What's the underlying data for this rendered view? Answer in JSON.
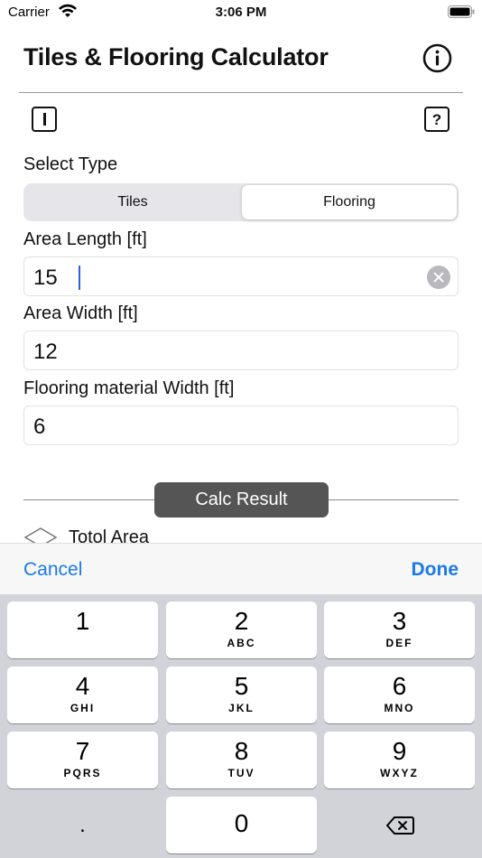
{
  "status_bar": {
    "carrier": "Carrier",
    "time": "3:06 PM"
  },
  "nav": {
    "title": "Tiles & Flooring Calculator",
    "info_icon": "info-circle-icon"
  },
  "toolbar": {
    "left_icon": "I",
    "right_icon": "?"
  },
  "select_type": {
    "label": "Select Type",
    "options": [
      "Tiles",
      "Flooring"
    ],
    "selected": "Flooring"
  },
  "fields": [
    {
      "label": "Area Length [ft]",
      "value": "15"
    },
    {
      "label": "Area Width [ft]",
      "value": "12"
    },
    {
      "label": "Flooring material Width [ft]",
      "value": "6"
    }
  ],
  "calc": {
    "button_label": "Calc Result"
  },
  "results": {
    "total_area_label": "Totol Area"
  },
  "accessory": {
    "cancel": "Cancel",
    "done": "Done"
  },
  "keypad": {
    "keys": [
      {
        "digit": "1",
        "letters": ""
      },
      {
        "digit": "2",
        "letters": "ABC"
      },
      {
        "digit": "3",
        "letters": "DEF"
      },
      {
        "digit": "4",
        "letters": "GHI"
      },
      {
        "digit": "5",
        "letters": "JKL"
      },
      {
        "digit": "6",
        "letters": "MNO"
      },
      {
        "digit": "7",
        "letters": "PQRS"
      },
      {
        "digit": "8",
        "letters": "TUV"
      },
      {
        "digit": "9",
        "letters": "WXYZ"
      },
      {
        "digit": "0",
        "letters": ""
      }
    ],
    "decimal": ".",
    "delete_icon": "backspace-icon"
  },
  "colors": {
    "accent": "#1b7ae6",
    "calc_button": "#555555",
    "keyboard_bg": "#d1d3d9"
  }
}
